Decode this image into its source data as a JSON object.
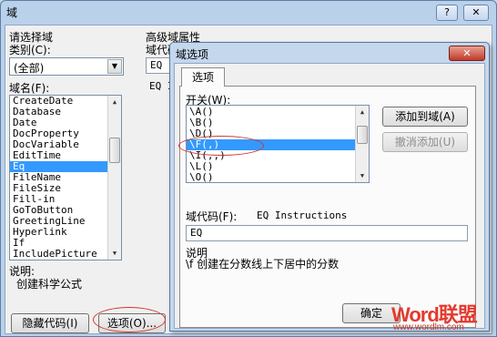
{
  "outer": {
    "title": "域",
    "help_label": "?",
    "close_label": "✕",
    "select_field_label": "请选择域",
    "category_label": "类别(C):",
    "category_value": "(全部)",
    "field_names_label": "域名(F):",
    "field_names": [
      "CreateDate",
      "Database",
      "Date",
      "DocProperty",
      "DocVariable",
      "EditTime",
      "Eq",
      "FileName",
      "FileSize",
      "Fill-in",
      "GoToButton",
      "GreetingLine",
      "Hyperlink",
      "If",
      "IncludePicture"
    ],
    "selected_field": "Eq",
    "advanced_label": "高级域属性",
    "field_code_label": "域代码",
    "field_code_value": "EQ",
    "field_code_preview": "EQ Ins",
    "description_label": "说明:",
    "description_text": "创建科学公式",
    "hide_codes_button": "隐藏代码(I)",
    "options_button": "选项(O)..."
  },
  "inner": {
    "title": "域选项",
    "close_label": "✕",
    "tab_label": "选项",
    "switches_label": "开关(W):",
    "switches": [
      "\\A()",
      "\\B()",
      "\\D()",
      "\\F(,)",
      "\\I(,,)",
      "\\L()",
      "\\O()"
    ],
    "selected_switch": "\\F(,)",
    "add_button": "添加到域(A)",
    "undo_button": "撤消添加(U)",
    "field_code_label": "域代码(F):",
    "field_code_hint": "EQ Instructions",
    "field_code_value": "EQ",
    "description_label": "说明",
    "description_text": "\\f 创建在分数线上下居中的分数",
    "ok_button": "确定"
  },
  "watermark": {
    "logo_text": "Word联盟",
    "url": "www.wordlm.com"
  },
  "colors": {
    "selection": "#3399ff",
    "highlight_oval": "#d2352e",
    "title_frame": "#b9d1ea"
  }
}
